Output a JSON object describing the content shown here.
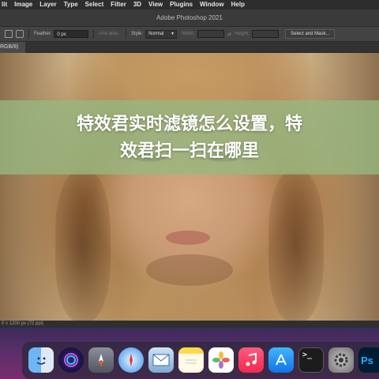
{
  "menubar": {
    "items": [
      "lit",
      "Image",
      "Layer",
      "Type",
      "Select",
      "Filter",
      "3D",
      "View",
      "Plugins",
      "Window",
      "Help"
    ]
  },
  "titlebar": {
    "title": "Adobe Photoshop 2021"
  },
  "options": {
    "feather_label": "Feather:",
    "feather_value": "0 px",
    "antialias_label": "Anti-alias",
    "style_label": "Style:",
    "style_value": "Normal",
    "width_label": "Width:",
    "height_label": "Height:",
    "mask_button": "Select and Mask..."
  },
  "document": {
    "tab_label": "RGB/8)"
  },
  "headline": {
    "line1": "特效君实时滤镜怎么设置，特",
    "line2": "效君扫一扫在哪里"
  },
  "status": {
    "text": "0 x 1200 px (72 ppi)"
  },
  "dock": {
    "icons": [
      "finder-icon",
      "siri-icon",
      "launchpad-icon",
      "safari-icon",
      "mail-icon",
      "notes-icon",
      "photos-icon",
      "music-icon",
      "app-store-icon",
      "terminal-icon",
      "system-preferences-icon",
      "photoshop-icon"
    ],
    "terminal_glyph": ">_",
    "photoshop_glyph": "Ps"
  },
  "colors": {
    "banner": "#96b982",
    "menubar": "#2d2d2d",
    "desktop": "#5a2f6a"
  }
}
